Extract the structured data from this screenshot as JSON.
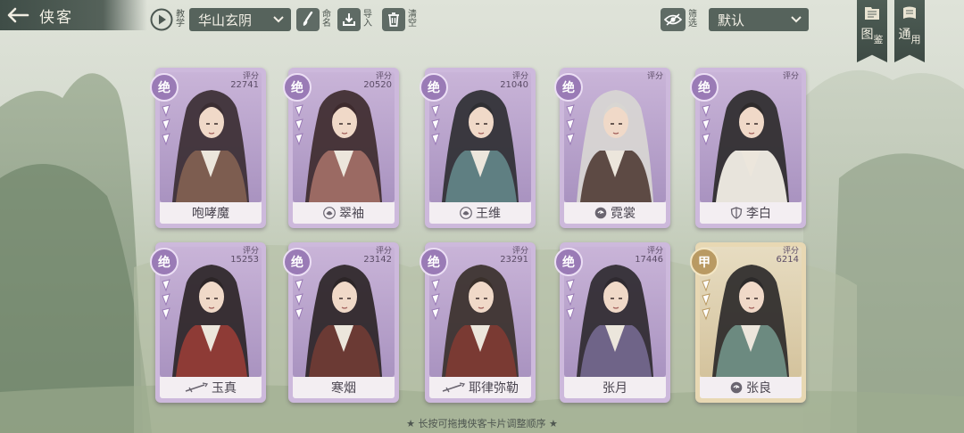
{
  "header": {
    "title": "侠客",
    "tutorial_label": "教学",
    "faction_selected": "华山玄阴",
    "rename_label": "命名",
    "import_label": "导入",
    "clear_label": "清空",
    "filter_label": "筛选",
    "sort_selected": "默认",
    "atlas_label": [
      "图",
      "鉴"
    ],
    "general_label": [
      "通",
      "用"
    ]
  },
  "colors": {
    "jue": "#9a7bb6",
    "jia": "#b99a63",
    "jue_frame": "#cdb9dc",
    "jia_frame": "#e8d8b3"
  },
  "cards": [
    {
      "name": "咆哮魔",
      "score_label": "评分",
      "score": "22741",
      "rank": "绝",
      "faction_icon": "",
      "tier": "jue"
    },
    {
      "name": "翠袖",
      "score_label": "评分",
      "score": "20520",
      "rank": "绝",
      "faction_icon": "lotus-icon",
      "tier": "jue"
    },
    {
      "name": "王维",
      "score_label": "评分",
      "score": "21040",
      "rank": "绝",
      "faction_icon": "lotus-icon",
      "tier": "jue"
    },
    {
      "name": "霓裳",
      "score_label": "评分",
      "score": "",
      "rank": "绝",
      "faction_icon": "swirl-icon",
      "tier": "jue"
    },
    {
      "name": "李白",
      "score_label": "评分",
      "score": "",
      "rank": "绝",
      "faction_icon": "shield-icon",
      "tier": "jue"
    },
    {
      "name": "玉真",
      "score_label": "评分",
      "score": "15253",
      "rank": "绝",
      "faction_icon": "sword-icon",
      "tier": "jue"
    },
    {
      "name": "寒烟",
      "score_label": "评分",
      "score": "23142",
      "rank": "绝",
      "faction_icon": "",
      "tier": "jue"
    },
    {
      "name": "耶律弥勒",
      "score_label": "评分",
      "score": "23291",
      "rank": "绝",
      "faction_icon": "sword-icon",
      "tier": "jue"
    },
    {
      "name": "张月",
      "score_label": "评分",
      "score": "17446",
      "rank": "绝",
      "faction_icon": "",
      "tier": "jue"
    },
    {
      "name": "张良",
      "score_label": "评分",
      "score": "6214",
      "rank": "甲",
      "faction_icon": "swirl-icon",
      "tier": "jia"
    }
  ],
  "hint": "★ 长按可拖拽侠客卡片调整顺序 ★"
}
